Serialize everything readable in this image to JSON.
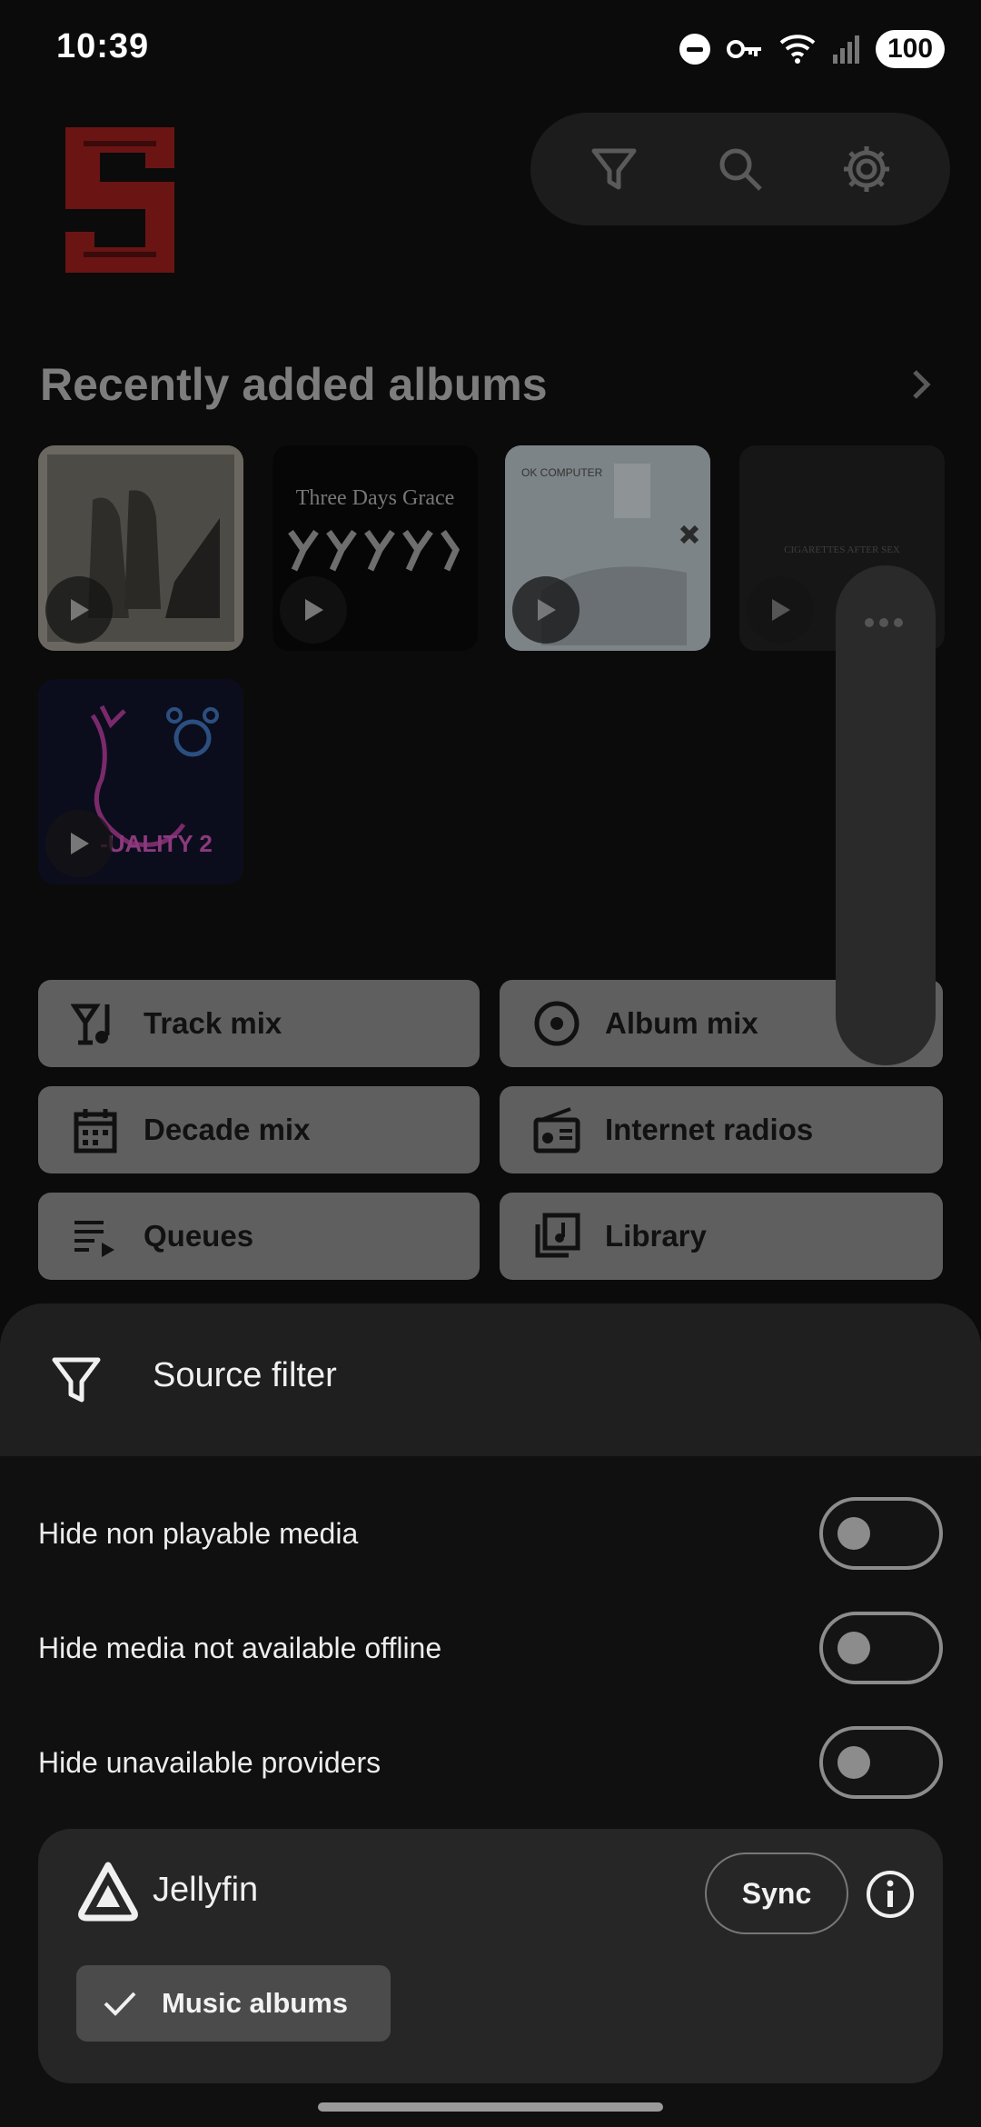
{
  "status_bar": {
    "time": "10:39",
    "battery": "100"
  },
  "home": {
    "section_title": "Recently added albums",
    "albums": [
      {
        "name": "album-1",
        "art_text": ""
      },
      {
        "name": "album-2",
        "art_text": "Three Days Grace"
      },
      {
        "name": "album-3",
        "art_text": "OK COMPUTER"
      },
      {
        "name": "album-4",
        "art_text": "CIGARETTES AFTER SEX"
      },
      {
        "name": "album-5",
        "art_text": "-UALITY 2"
      }
    ],
    "mix_buttons": [
      {
        "label": "Track mix",
        "icon": "track-mix-icon"
      },
      {
        "label": "Album mix",
        "icon": "album-mix-icon"
      },
      {
        "label": "Decade mix",
        "icon": "calendar-icon"
      },
      {
        "label": "Internet radios",
        "icon": "radio-icon"
      },
      {
        "label": "Queues",
        "icon": "queue-icon"
      },
      {
        "label": "Library",
        "icon": "library-icon"
      }
    ]
  },
  "sheet": {
    "title": "Source filter",
    "toggles": [
      {
        "label": "Hide non playable media",
        "on": false
      },
      {
        "label": "Hide media not available offline",
        "on": false
      },
      {
        "label": "Hide unavailable providers",
        "on": false
      }
    ],
    "provider": {
      "name": "Jellyfin",
      "sync_label": "Sync",
      "chip_label": "Music albums",
      "chip_selected": true
    }
  },
  "colors": {
    "accent": "#8b1a1a",
    "sheet_bg": "#101010",
    "card_bg": "#262626"
  }
}
